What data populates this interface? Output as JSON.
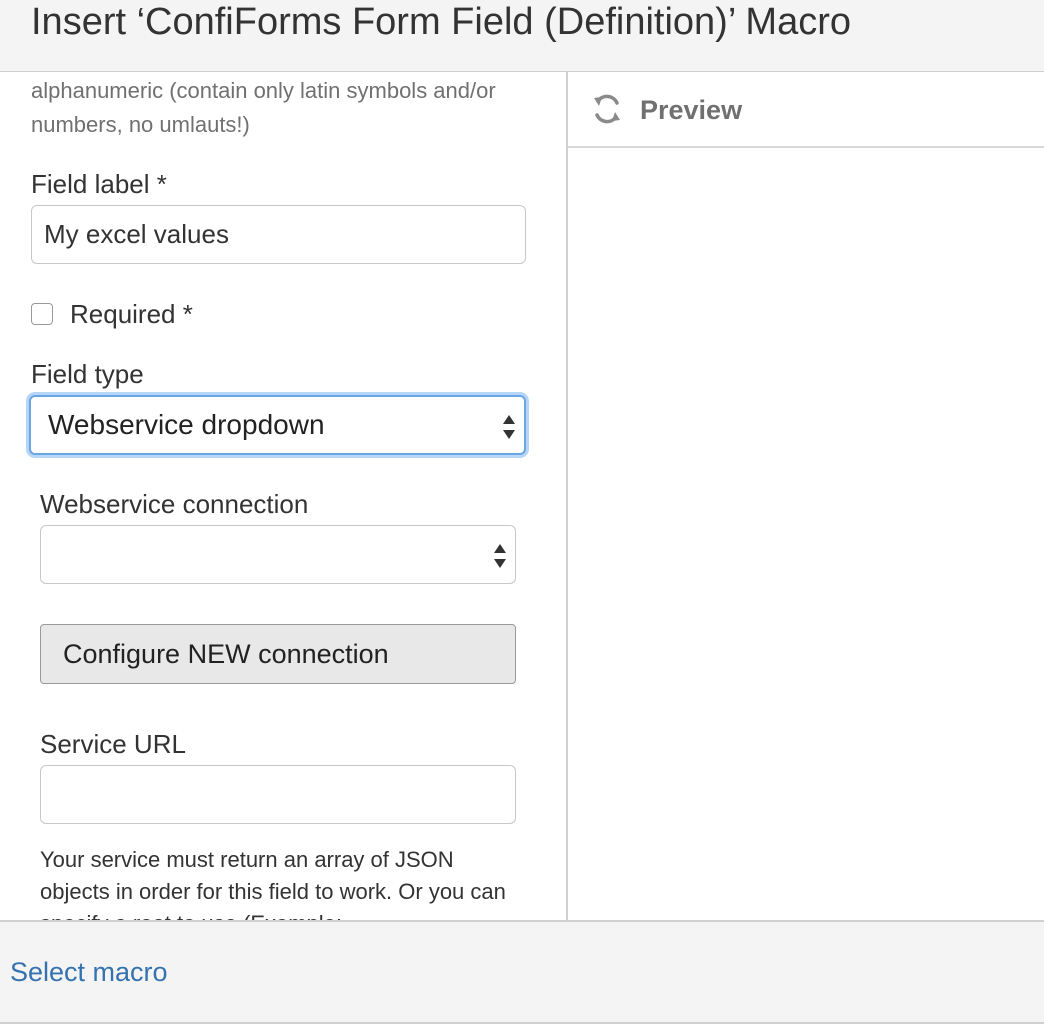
{
  "dialog": {
    "title": "Insert ‘ConfiForms Form Field (Definition)’ Macro"
  },
  "form": {
    "name_hint": "alphanumeric (contain only latin symbols and/or numbers, no umlauts!)",
    "field_label": {
      "label": "Field label *",
      "value": "My excel values"
    },
    "required": {
      "label": "Required *",
      "checked": false
    },
    "field_type": {
      "label": "Field type",
      "selected": "Webservice dropdown"
    },
    "webservice_connection": {
      "label": "Webservice connection",
      "selected": ""
    },
    "configure_button": {
      "label": "Configure NEW connection"
    },
    "service_url": {
      "label": "Service URL",
      "value": ""
    },
    "service_help": "Your service must return an array of JSON objects in order for this field to work. Or you can specify a root to use (Example:"
  },
  "preview": {
    "label": "Preview",
    "icon": "refresh-icon"
  },
  "footer": {
    "select_macro_label": "Select macro"
  },
  "colors": {
    "link": "#3572b0",
    "focus": "#6aa6e6",
    "muted_text": "#707070",
    "header_bg": "#f4f4f4"
  }
}
